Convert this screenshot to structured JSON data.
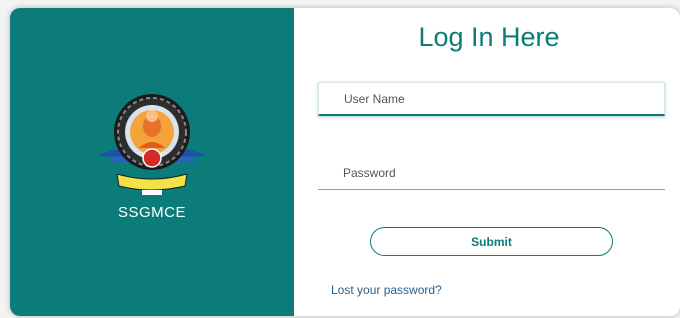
{
  "left_panel": {
    "brand_name": "SSGMCE",
    "logo_icon": "college-emblem-logo",
    "background_color": "#0b7c7a"
  },
  "login_form": {
    "title": "Log In Here",
    "username_placeholder": "User Name",
    "password_placeholder": "Password",
    "submit_label": "Submit",
    "lost_password_link": "Lost your password?",
    "accent_color": "#0b7c7a"
  }
}
